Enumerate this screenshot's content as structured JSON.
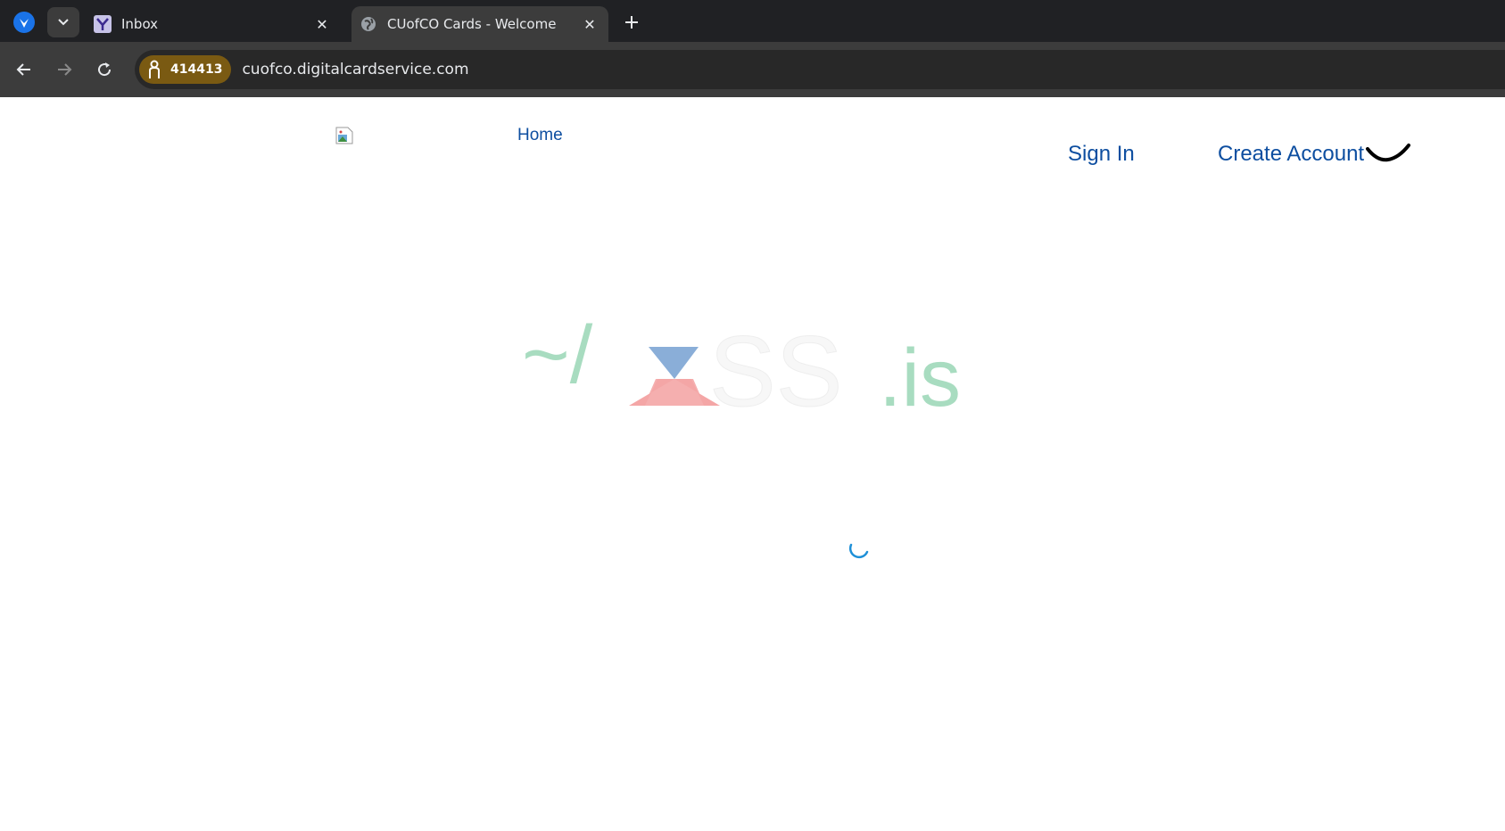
{
  "browser": {
    "tabs": [
      {
        "title": "Inbox",
        "favicon": "yahoo-y-icon",
        "active": false
      },
      {
        "title": "CUofCO Cards - Welcome",
        "favicon": "globe-icon",
        "active": true
      }
    ],
    "address_bar": {
      "badge_text": "414413",
      "url": "cuofco.digitalcardservice.com"
    }
  },
  "page": {
    "nav": {
      "home_label": "Home",
      "signin_label": "Sign In",
      "create_account_label": "Create Account"
    },
    "watermark": {
      "prefix": "~/",
      "x_letter": "X",
      "ss": "SS",
      "suffix": ".is"
    }
  },
  "colors": {
    "tabstrip": "#202124",
    "toolbar": "#3c3c3c",
    "badge": "#7a5a12",
    "link": "#0d4ea0",
    "watermark_green": "#a8dcc0",
    "watermark_blue": "#8aaed8",
    "watermark_red": "#f4a6a6",
    "spinner": "#1e90d8"
  }
}
